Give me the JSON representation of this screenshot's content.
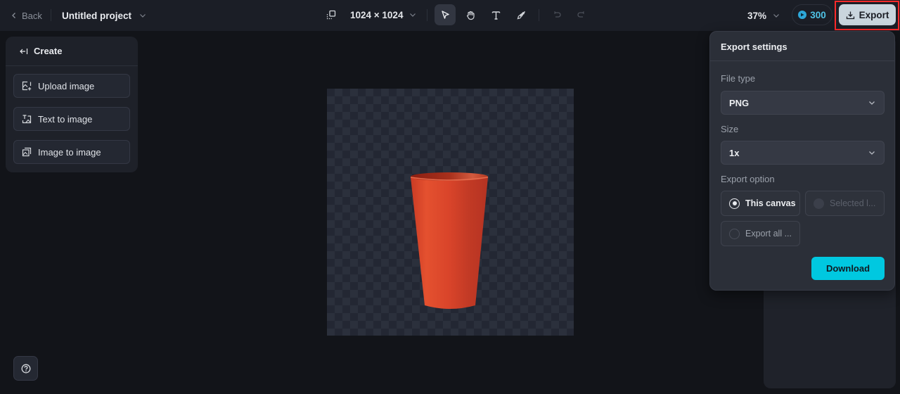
{
  "topbar": {
    "back_label": "Back",
    "project_title": "Untitled project",
    "canvas_size": "1024 × 1024",
    "zoom_level": "37%",
    "credits": "300",
    "export_label": "Export",
    "tools": [
      {
        "name": "select",
        "icon": "cursor-arrow-icon",
        "active": true
      },
      {
        "name": "hand",
        "icon": "hand-icon",
        "active": false
      },
      {
        "name": "text",
        "icon": "text-icon",
        "active": false
      },
      {
        "name": "brush",
        "icon": "brush-icon",
        "active": false
      },
      {
        "name": "undo",
        "icon": "undo-icon",
        "enabled": false
      },
      {
        "name": "redo",
        "icon": "redo-icon",
        "enabled": false
      }
    ]
  },
  "create_panel": {
    "title": "Create",
    "items": [
      {
        "label": "Upload image",
        "icon": "upload-image-icon"
      },
      {
        "label": "Text to image",
        "icon": "text-to-image-icon"
      },
      {
        "label": "Image to image",
        "icon": "image-to-image-icon"
      }
    ]
  },
  "canvas": {
    "content": "Red tumbler cup on transparent background"
  },
  "export_settings": {
    "title": "Export settings",
    "file_type_label": "File type",
    "file_type_value": "PNG",
    "size_label": "Size",
    "size_value": "1x",
    "export_option_label": "Export option",
    "options": [
      {
        "label": "This canvas",
        "selected": true,
        "disabled": false
      },
      {
        "label": "Selected l...",
        "selected": false,
        "disabled": true
      },
      {
        "label": "Export all ...",
        "selected": false,
        "disabled": false
      }
    ],
    "download_label": "Download"
  },
  "colors": {
    "accent": "#00c8e0",
    "credits": "#4fc3e6",
    "highlight": "#ff2a2a"
  }
}
